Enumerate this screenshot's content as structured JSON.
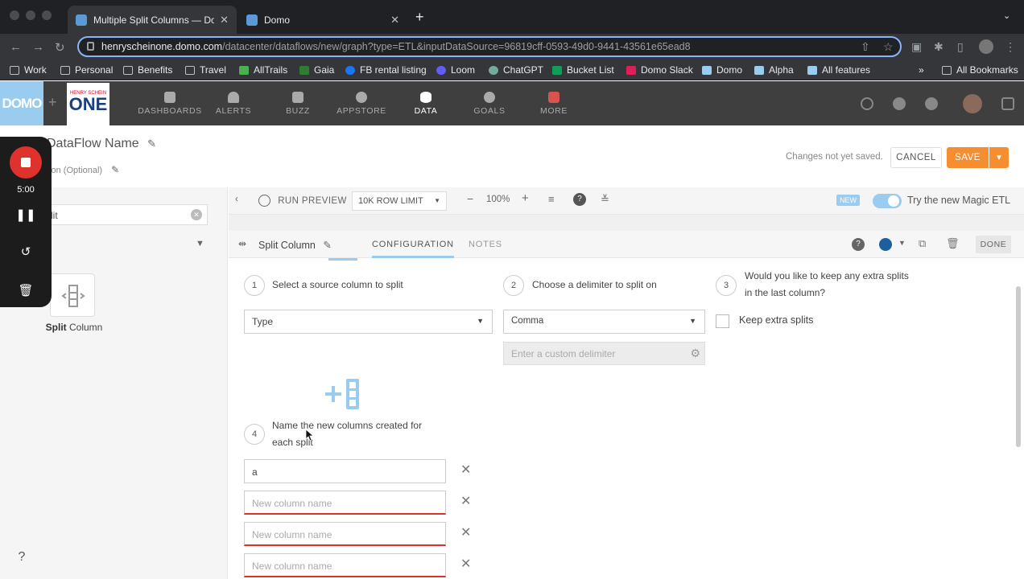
{
  "browser": {
    "tabs": [
      {
        "title": "Multiple Split Columns — Dom",
        "active": true
      },
      {
        "title": "Domo",
        "active": false
      }
    ],
    "url_host": "henryscheinone.domo.com",
    "url_path": "/datacenter/dataflows/new/graph?type=ETL&inputDataSource=96819cff-0593-49d0-9441-43561e65ead8",
    "bookmarks": [
      "Work",
      "Personal",
      "Benefits",
      "Travel",
      "AllTrails",
      "Gaia",
      "FB rental listing",
      "Loom",
      "ChatGPT",
      "Bucket List",
      "Domo Slack",
      "Domo",
      "Alpha",
      "All features"
    ],
    "all_bookmarks": "All Bookmarks",
    "more_bookmarks": "»"
  },
  "nav": {
    "logo": "DOMO",
    "brand_small": "HENRY SCHEIN",
    "brand_big": "ONE",
    "items": [
      "DASHBOARDS",
      "ALERTS",
      "BUZZ",
      "APPSTORE",
      "DATA",
      "GOALS",
      "MORE"
    ],
    "active": "DATA"
  },
  "header": {
    "dataflow_name": "DataFlow Name",
    "description_placeholder": "tion (Optional)",
    "status": "Changes not yet saved.",
    "cancel": "CANCEL",
    "save": "SAVE"
  },
  "recorder": {
    "time": "5:00"
  },
  "left_panel": {
    "search_value": "lit",
    "tile_label_bold": "Split",
    "tile_label_rest": " Column"
  },
  "toolbar": {
    "run_preview": "RUN PREVIEW",
    "row_limit": "10K ROW LIMIT",
    "zoom": "100%",
    "new_badge": "NEW",
    "magic_label": "Try the new Magic ETL"
  },
  "tile": {
    "name": "Split Column",
    "tabs": [
      "CONFIGURATION",
      "NOTES"
    ],
    "done": "DONE"
  },
  "config": {
    "step1": {
      "num": "1",
      "label": "Select a source column to split",
      "value": "Type"
    },
    "step2": {
      "num": "2",
      "label": "Choose a delimiter to split on",
      "value": "Comma",
      "custom_placeholder": "Enter a custom delimiter"
    },
    "step3": {
      "num": "3",
      "label": "Would you like to keep any extra splits in the last column?",
      "checkbox_label": "Keep extra splits",
      "checked": false
    },
    "step4": {
      "num": "4",
      "label": "Name the new columns created for each split"
    },
    "columns": [
      {
        "value": "a",
        "placeholder": ""
      },
      {
        "value": "",
        "placeholder": "New column name"
      },
      {
        "value": "",
        "placeholder": "New column name"
      },
      {
        "value": "",
        "placeholder": "New column name"
      }
    ]
  },
  "help": "?"
}
